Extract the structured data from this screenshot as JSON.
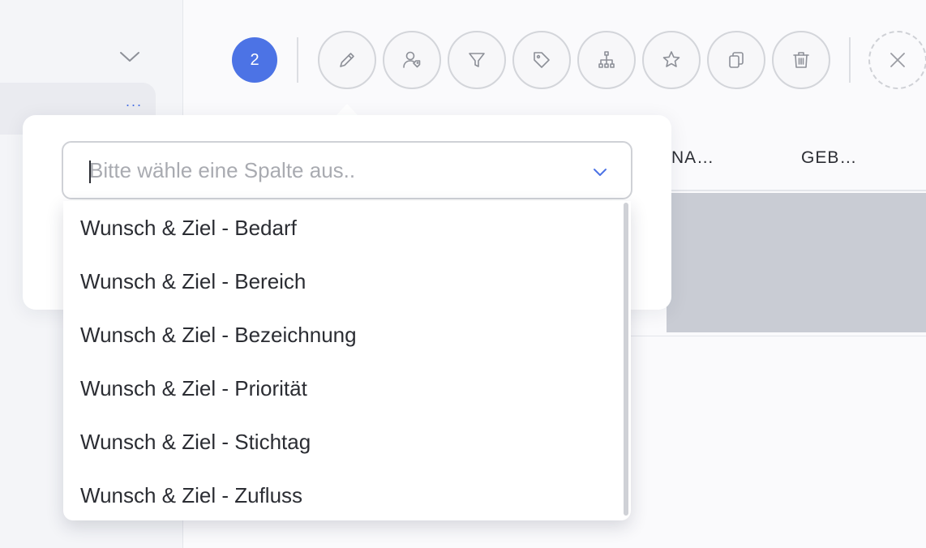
{
  "sidebar": {
    "collapse_icon": "chevron-down-icon",
    "more_icon": "more-horizontal-icon",
    "more_label": "..."
  },
  "toolbar": {
    "selected_count": "2",
    "buttons": [
      {
        "name": "edit",
        "icon": "pencil-icon"
      },
      {
        "name": "assign-user",
        "icon": "user-tag-icon"
      },
      {
        "name": "filter",
        "icon": "filter-icon"
      },
      {
        "name": "tag",
        "icon": "tag-icon"
      },
      {
        "name": "hierarchy",
        "icon": "hierarchy-icon"
      },
      {
        "name": "favorite",
        "icon": "star-icon"
      },
      {
        "name": "copy",
        "icon": "copy-icon"
      },
      {
        "name": "delete",
        "icon": "trash-icon"
      }
    ],
    "close_icon": "close-icon"
  },
  "table": {
    "columns": [
      "NA…",
      "GEB…"
    ]
  },
  "column_select": {
    "placeholder": "Bitte wähle eine Spalte aus..",
    "chevron_icon": "chevron-down-icon",
    "options": [
      "Wunsch & Ziel - Bedarf",
      "Wunsch & Ziel - Bereich",
      "Wunsch & Ziel - Bezeichnung",
      "Wunsch & Ziel - Priorität",
      "Wunsch & Ziel - Stichtag",
      "Wunsch & Ziel - Zufluss"
    ]
  },
  "colors": {
    "accent": "#4c73e5",
    "icon_stroke": "#8d9098",
    "selected_row": "#c9ccd4"
  }
}
